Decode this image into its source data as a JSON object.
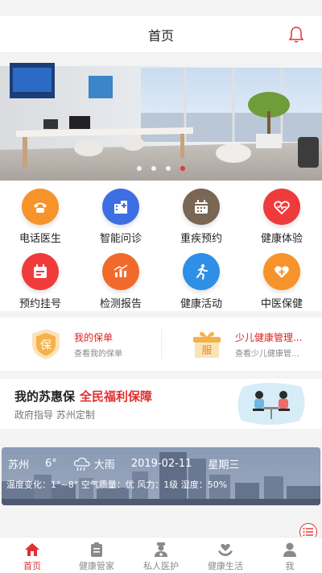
{
  "header": {
    "title": "首页"
  },
  "banner": {
    "dot_count": 4,
    "active_dot": 3
  },
  "services": [
    {
      "label": "电话医生",
      "icon": "phone-icon",
      "color": "#f7932b"
    },
    {
      "label": "智能问诊",
      "icon": "hospital-icon",
      "color": "#3d6fe3"
    },
    {
      "label": "重疾预约",
      "icon": "calendar-icon",
      "color": "#7a6655"
    },
    {
      "label": "健康体验",
      "icon": "heart-pulse-icon",
      "color": "#ef3b3b"
    },
    {
      "label": "预约挂号",
      "icon": "register-icon",
      "color": "#ef3b3b"
    },
    {
      "label": "检测报告",
      "icon": "bar-chart-icon",
      "color": "#f26a2b"
    },
    {
      "label": "健康活动",
      "icon": "running-icon",
      "color": "#2f8fe6"
    },
    {
      "label": "中医保健",
      "icon": "heart-plus-icon",
      "color": "#f7932b"
    }
  ],
  "policy": {
    "left": {
      "badge": "保",
      "title": "我的保单",
      "subtitle": "查看我的保单"
    },
    "right": {
      "badge": "服",
      "title": "少儿健康管理...",
      "subtitle": "查看少儿健康管..."
    }
  },
  "suhuibao": {
    "title": "我的苏惠保",
    "highlight": "全民福利保障",
    "subtitle": "政府指导 苏州定制"
  },
  "weather": {
    "city": "苏州",
    "temp": "6°",
    "condition": "大雨",
    "date": "2019-02-11",
    "weekday": "星期三",
    "details": "温度变化：1°~8° 空气质量：优 风力：1级 湿度：50%"
  },
  "tabs": [
    {
      "label": "首页",
      "icon": "home-icon",
      "active": true
    },
    {
      "label": "健康管家",
      "icon": "clipboard-icon",
      "active": false
    },
    {
      "label": "私人医护",
      "icon": "nurse-icon",
      "active": false
    },
    {
      "label": "健康生活",
      "icon": "heart-hands-icon",
      "active": false
    },
    {
      "label": "我",
      "icon": "user-icon",
      "active": false
    }
  ],
  "colors": {
    "accent": "#e0302f",
    "background": "#f4f4f4"
  }
}
